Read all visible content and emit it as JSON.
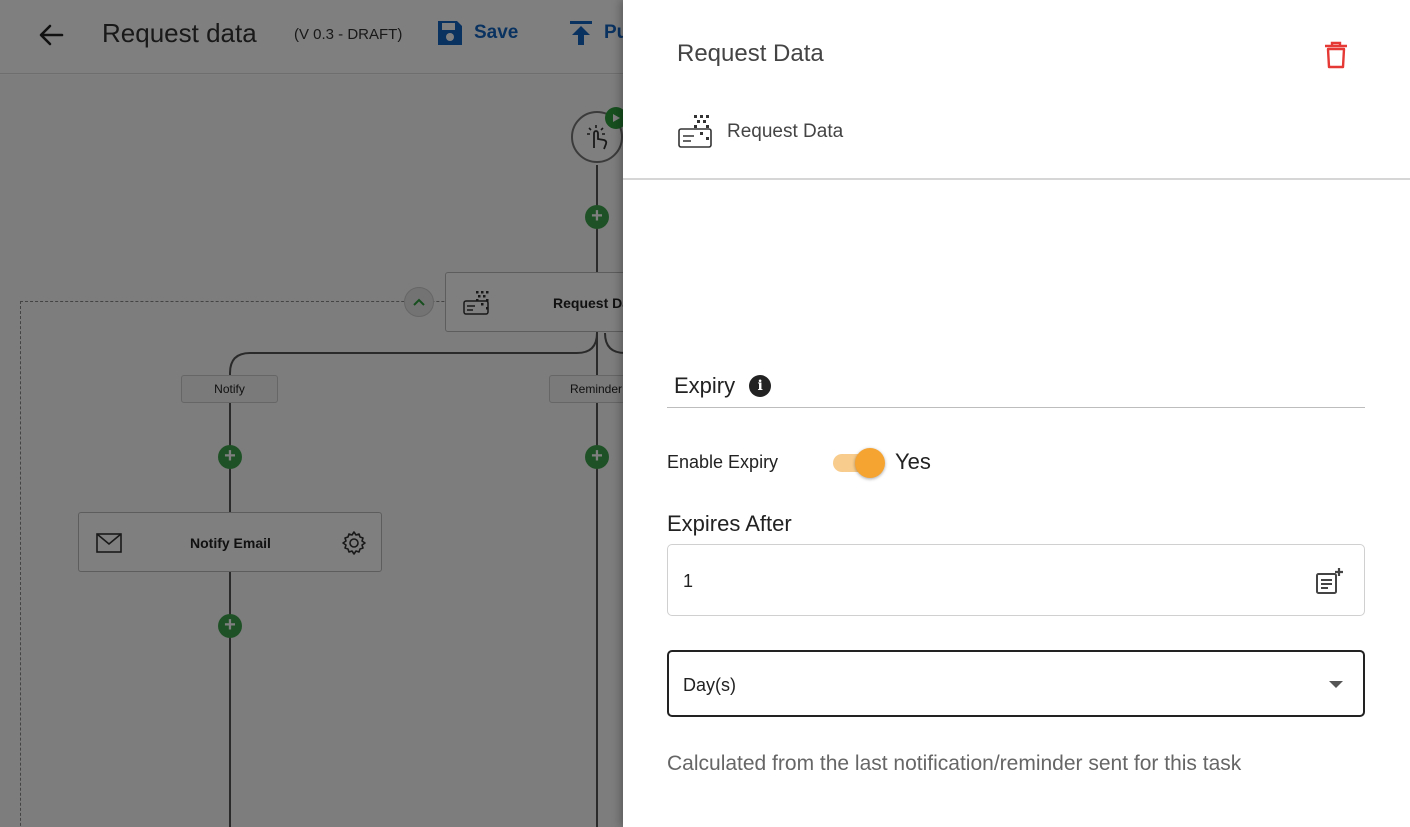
{
  "header": {
    "title": "Request data",
    "version": "(V 0.3 - DRAFT)",
    "save_label": "Save",
    "publish_label": "Pu"
  },
  "canvas": {
    "request_node_label": "Request Da",
    "branches": [
      "Notify",
      "Reminder"
    ],
    "notify_node_label": "Notify Email"
  },
  "drawer": {
    "title": "Request Data",
    "task_type_label": "Request Data",
    "section_title": "Expiry",
    "enable_expiry_label": "Enable Expiry",
    "enable_expiry_value": "Yes",
    "enable_expiry_on": true,
    "expires_after_label": "Expires After",
    "expires_after_value": "1",
    "unit_value": "Day(s)",
    "helper_text": "Calculated from the last notification/reminder sent for this task"
  },
  "colors": {
    "accent_blue": "#1565c0",
    "delete_red": "#e53935",
    "toggle_orange": "#f5a331",
    "add_green": "#3fa34d"
  },
  "icons": {
    "back": "arrow-left-icon",
    "save": "floppy-disk-icon",
    "publish": "upload-icon",
    "trigger": "tap-icon",
    "request_data": "data-card-icon",
    "notify": "envelope-icon",
    "settings": "gear-icon",
    "delete": "trash-icon",
    "info": "info-icon",
    "calculator": "calculated-field-icon",
    "dropdown": "caret-down-icon"
  }
}
